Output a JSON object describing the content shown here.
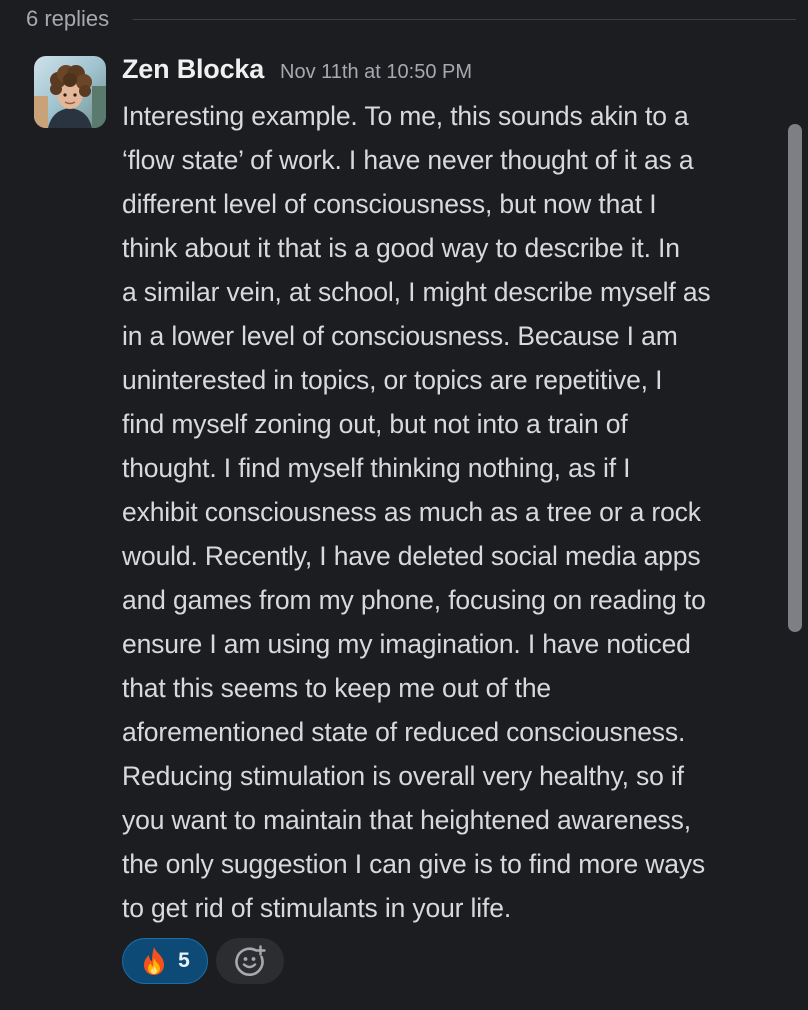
{
  "thread": {
    "replies_label": "6 replies"
  },
  "message": {
    "author": "Zen Blocka",
    "timestamp": "Nov 11th at 10:50 PM",
    "lines": [
      "Interesting example. To me, this sounds akin to a",
      "‘flow state’ of work. I have never thought of it as a",
      "different level of consciousness, but now that I",
      "think about it that is a good way to describe it. In",
      "a similar vein, at school, I might describe myself as",
      "in a lower level of consciousness. Because I am",
      "uninterested in topics, or topics are repetitive, I",
      "find myself zoning out, but not into a train of",
      "thought. I find myself thinking nothing, as if I",
      "exhibit consciousness as much as a tree or a rock",
      "would. Recently, I have deleted social media apps",
      "and games from my phone, focusing on reading to",
      "ensure I am using my imagination. I have noticed",
      "that this seems to keep me out of the",
      "aforementioned state of reduced consciousness.",
      "Reducing stimulation is overall very healthy, so if",
      "you want to maintain that heightened awareness,",
      "the only suggestion I can give is to find more ways",
      "to get rid of stimulants in your life."
    ]
  },
  "reactions": [
    {
      "emoji": "fire-icon",
      "glyph": "🔥",
      "count": "5"
    }
  ],
  "add_reaction": {
    "icon": "add-emoji-icon"
  },
  "colors": {
    "background": "#1b1d21",
    "text": "#d8d9db",
    "muted": "#a7a9ae",
    "reaction_bg": "#0d4a76",
    "reaction_border": "#1b6ca8"
  }
}
